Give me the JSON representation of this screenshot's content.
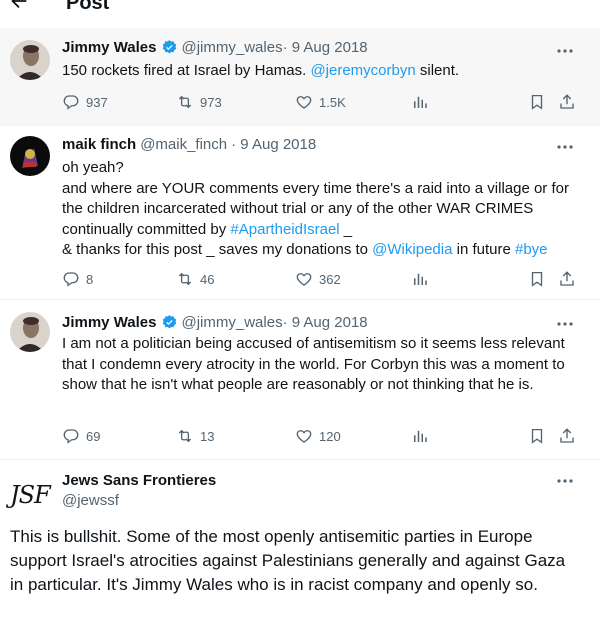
{
  "header": {
    "title": "Post"
  },
  "tweets": [
    {
      "name": "Jimmy Wales",
      "handle": "@jimmy_wales",
      "date": "· 9 Aug 2018",
      "text_before": "150 rockets fired at Israel by Hamas.  ",
      "mention": "@jeremycorbyn",
      "text_after": " silent.",
      "replies": "937",
      "retweets": "973",
      "likes": "1.5K"
    },
    {
      "name": "maik finch",
      "handle": "@maik_finch",
      "date": "· 9 Aug 2018",
      "line1": "oh yeah?",
      "line2": "and where are YOUR comments every time there's a raid into a village or for the children incarcerated without trial or any of the other WAR CRIMES continually committed by ",
      "hashtag1": "#ApartheidIsrael",
      "line2_end": " _",
      "line3_start": "& thanks for this post _ saves my donations to ",
      "mention": "@Wikipedia",
      "line3_mid": " in future ",
      "hashtag2": "#bye",
      "replies": "8",
      "retweets": "46",
      "likes": "362"
    },
    {
      "name": "Jimmy Wales",
      "handle": "@jimmy_wales",
      "date": "· 9 Aug 2018",
      "text": "I am not a politician being accused of antisemitism so it seems less relevant that I condemn every atrocity in the world.  For Corbyn this was a moment to show that he isn't what people are reasonably or not thinking that he is.",
      "replies": "69",
      "retweets": "13",
      "likes": "120"
    },
    {
      "name": "Jews Sans Frontieres",
      "handle": "@jewssf",
      "logo_text": "JSF",
      "text": "This is bullshit. Some of the most openly antisemitic parties in Europe support Israel's atrocities against Palestinians generally and against Gaza in particular. It's Jimmy Wales who is in racist company and openly so."
    }
  ],
  "colors": {
    "link": "#1d9bf0",
    "secondary": "#536471",
    "verified": "#1d9bf0"
  },
  "icons": [
    "back-arrow-icon",
    "verified-badge-icon",
    "more-icon",
    "reply-icon",
    "retweet-icon",
    "like-icon",
    "views-icon",
    "bookmark-icon",
    "share-icon"
  ]
}
